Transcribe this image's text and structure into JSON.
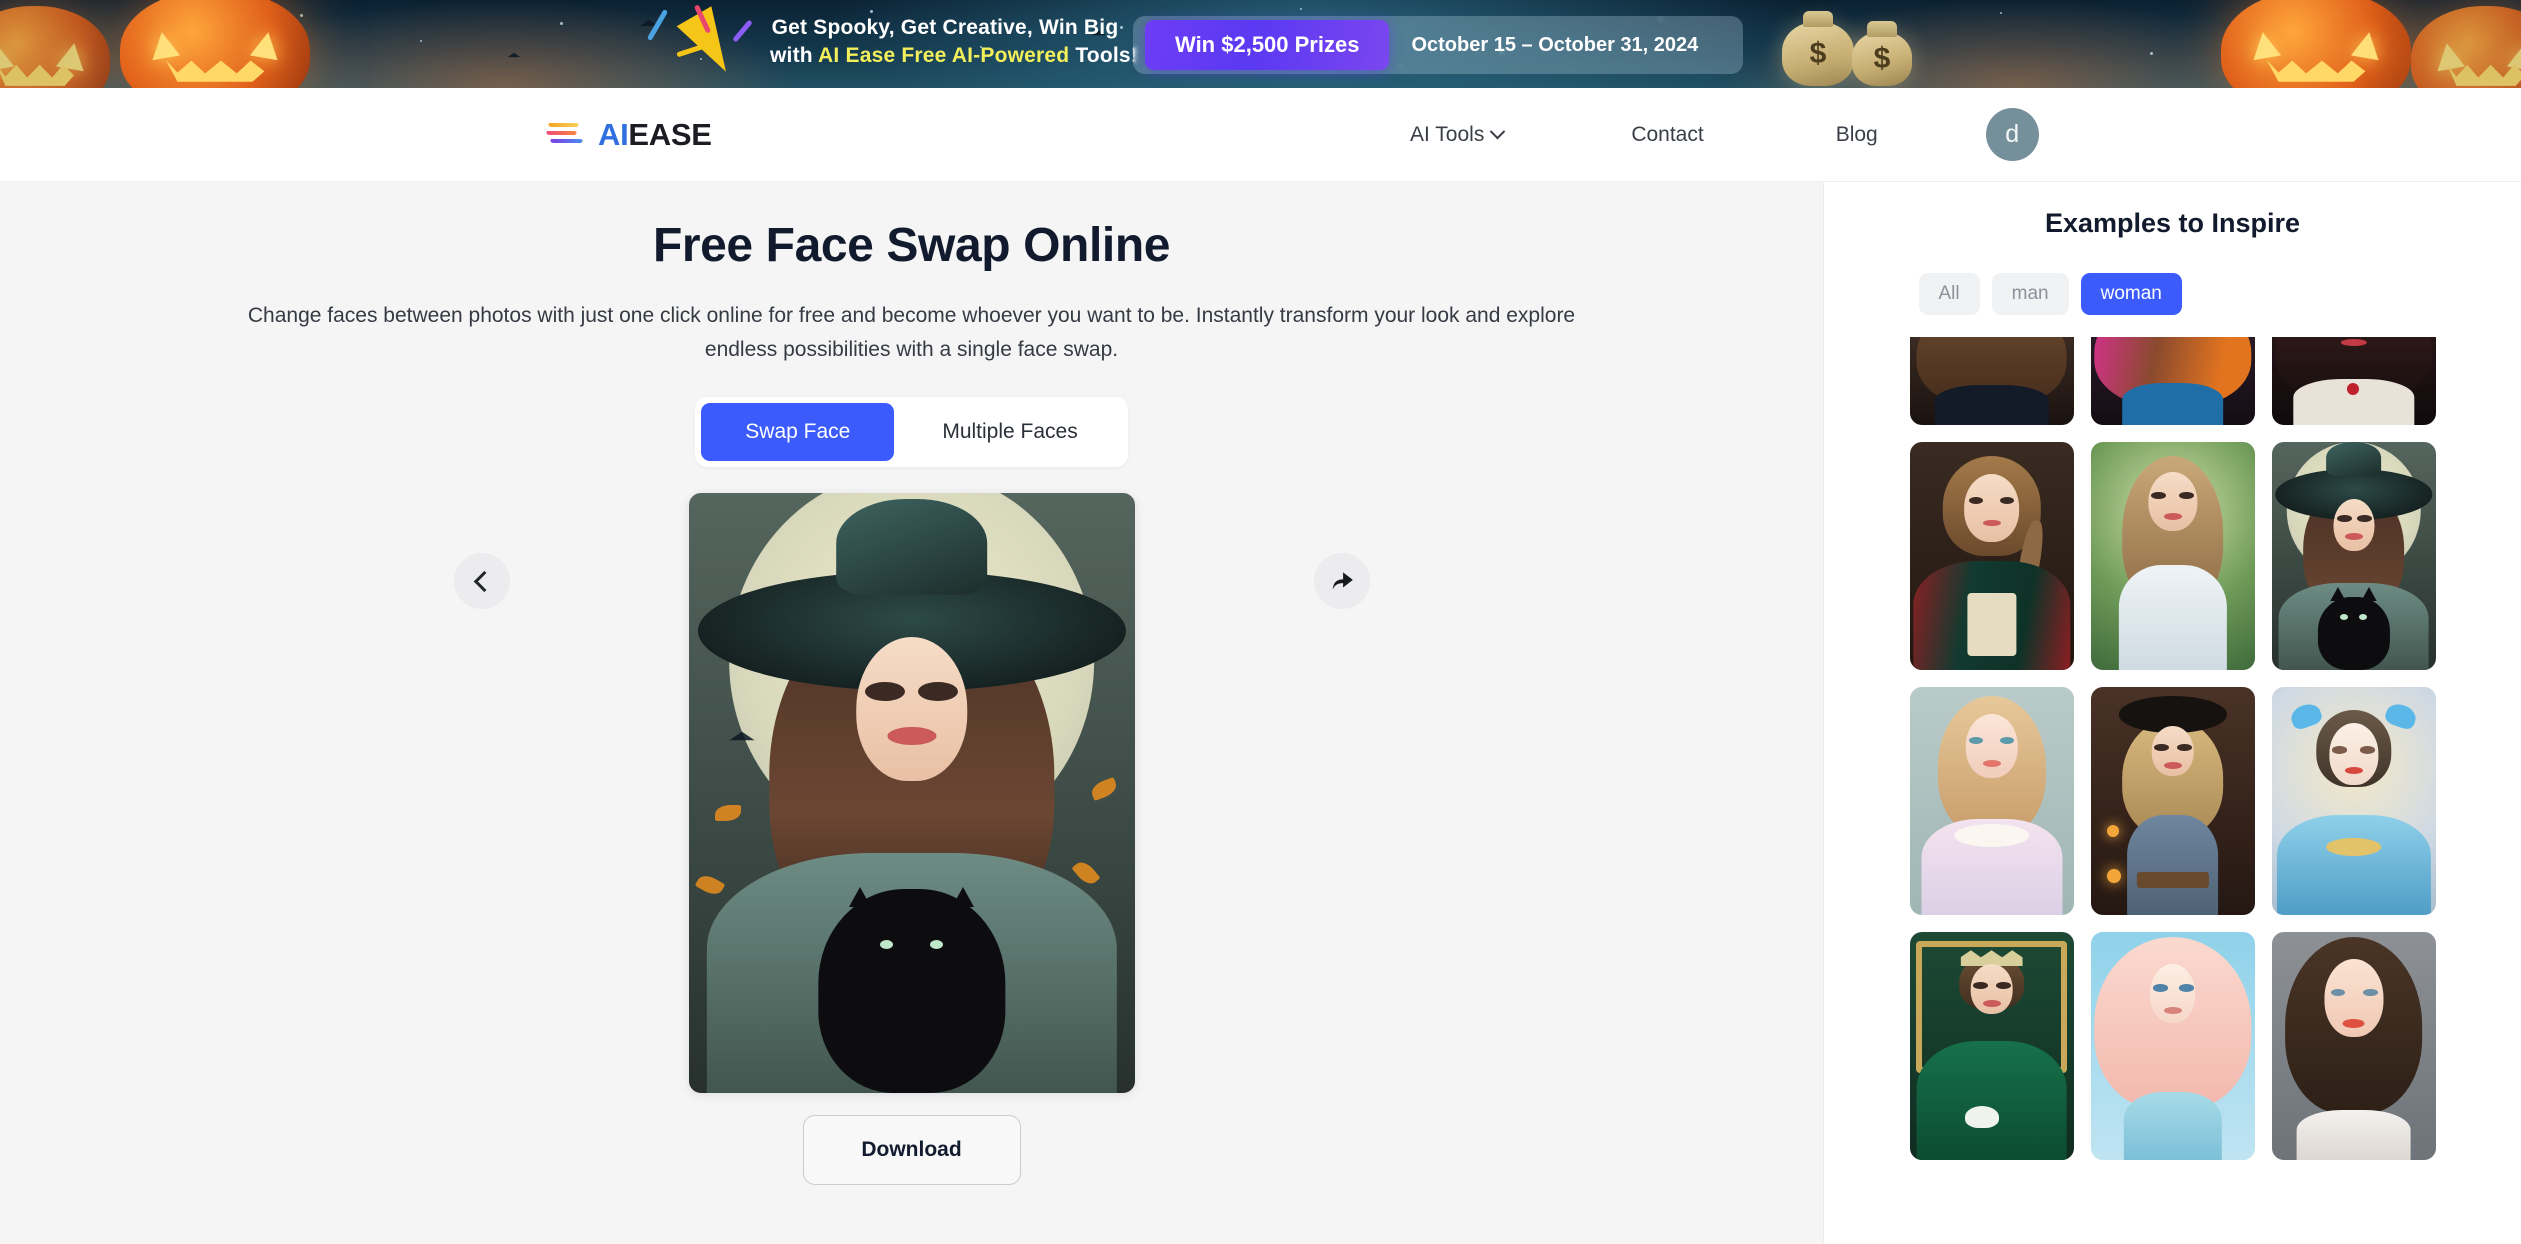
{
  "promo": {
    "line1": "Get Spooky, Get Creative, Win Big",
    "line2_pre": "with ",
    "line2_highlight": "AI Ease Free AI-Powered",
    "line2_post": " Tools!",
    "prize_label": "Win $2,500 Prizes",
    "dates": "October 15 – October 31, 2024",
    "accent": "#f2ef5a",
    "pill_color": "#6d3df5"
  },
  "header": {
    "brand_ai": "AI",
    "brand_ease": "EASE",
    "nav": [
      {
        "label": "AI Tools",
        "has_caret": true
      },
      {
        "label": "Contact",
        "has_caret": false
      },
      {
        "label": "Blog",
        "has_caret": false
      }
    ],
    "avatar_initial": "d",
    "avatar_color": "#76909b"
  },
  "main": {
    "title": "Free Face Swap Online",
    "subtitle": "Change faces between photos with just one click online for free and become whoever you want to be. Instantly transform your look and explore endless possibilities with a single face swap.",
    "tabs": [
      {
        "label": "Swap Face",
        "active": true
      },
      {
        "label": "Multiple Faces",
        "active": false
      }
    ],
    "active_tab_color": "#3b5bfd",
    "prev_icon": "chevron-left-icon",
    "share_icon": "share-arrow-icon",
    "result_alt": "Woman in witch hat holding a black cat",
    "download_label": "Download"
  },
  "examples": {
    "title": "Examples to Inspire",
    "filters": [
      {
        "label": "All",
        "active": false
      },
      {
        "label": "man",
        "active": false
      },
      {
        "label": "woman",
        "active": true
      }
    ],
    "active_filter_color": "#3b5bfd",
    "items": [
      {
        "alt": "Brunette woman in dark velvet dress",
        "clipped": true
      },
      {
        "alt": "Woman with colorful rainbow hair in blue dress",
        "clipped": true
      },
      {
        "alt": "Gothic woman with red jewel necklace",
        "clipped": true
      },
      {
        "alt": "Young woman with braided hair in renaissance gown",
        "clipped": false
      },
      {
        "alt": "Woman with long hair in white shirt in a garden",
        "clipped": false
      },
      {
        "alt": "Woman in witch hat holding a black cat",
        "clipped": false
      },
      {
        "alt": "Pastel fairy woman with pink collar dress",
        "clipped": false
      },
      {
        "alt": "Blonde woman in cowboy hat and denim vest",
        "clipped": false
      },
      {
        "alt": "Blue butterfly fairy woman with gold jewelry",
        "clipped": false
      },
      {
        "alt": "Victorian woman in green gown holding teacup",
        "clipped": false
      },
      {
        "alt": "Woman with pink hair and blue sky background",
        "clipped": false
      },
      {
        "alt": "Brunette woman with blue eyes portrait",
        "clipped": false
      }
    ]
  }
}
